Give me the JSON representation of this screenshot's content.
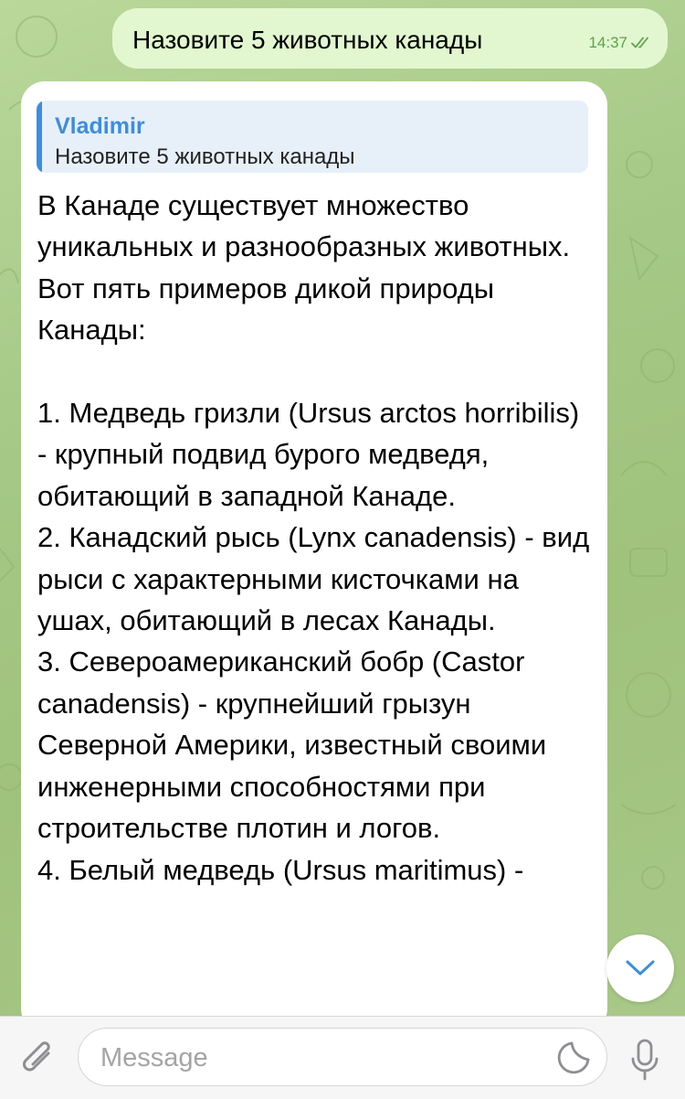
{
  "outgoing": {
    "text": "Назовите 5 животных канады",
    "time": "14:37",
    "status_icon": "double-check-icon"
  },
  "incoming": {
    "reply": {
      "name": "Vladimir",
      "text": "Назовите 5 животных канады"
    },
    "text": "В Канаде существует множество уникальных и разнообразных животных. Вот пять примеров дикой природы Канады:\n\n1. Медведь гризли (Ursus arctos horribilis) - крупный подвид бурого медведя, обитающий в западной Канаде.\n2. Канадский рысь (Lynx canadensis) - вид рыси с характерными кисточками на ушах, обитающий в лесах Канады.\n3. Североамериканский бобр (Castor canadensis) - крупнейший грызун Северной Америки, известный своими инженерными способностями при строительстве плотин и логов.\n4. Белый медведь (Ursus maritimus) -"
  },
  "scroll_button": {
    "icon": "chevron-down-icon"
  },
  "input_bar": {
    "placeholder": "Message",
    "attach_icon": "paperclip-icon",
    "sticker_icon": "sticker-icon",
    "mic_icon": "microphone-icon"
  },
  "colors": {
    "accent": "#3d8de0",
    "outgoing_bubble": "#e2f7cf",
    "time_green": "#5aa34c",
    "wallpaper": "#a5c886"
  }
}
